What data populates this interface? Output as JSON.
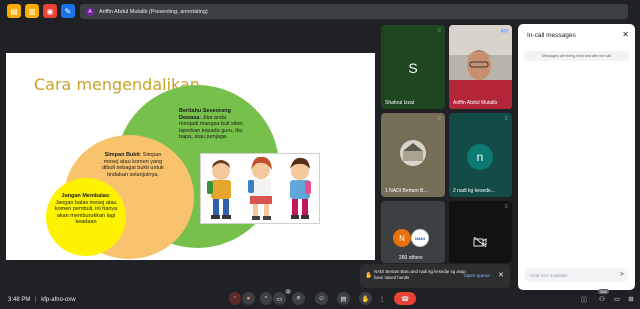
{
  "top_bar": {
    "presenting": {
      "avatar_letter": "A",
      "text": "Ariffin Abdul Mutalib (Presenting, annotating)"
    }
  },
  "slide": {
    "title": "Cara mengendalikan",
    "green": {
      "heading": "Beritahu Seseorang Dewasa",
      "body": ": Jika anda menjadi mangsa buli siber, laporkan kepada guru, ibu bapa, atau penjaga."
    },
    "orange": {
      "heading": "Simpan Bukti",
      "body": ": Simpan mesej atau komen yang dibuli sebagai bukti untuk tindakan selanjutnya."
    },
    "yellow": {
      "heading": "Jangan Membalas",
      "body": ": Jangan balas mesej atau komen pembuli, ini hanya akan memburukkan lagi keadaan"
    }
  },
  "participants": [
    {
      "letter": "S",
      "name": "Shahrul Izzat"
    },
    {
      "name": "Ariffin Abdul Mutalib"
    },
    {
      "name": "1⁨ NADI Bertam B..."
    },
    {
      "letter": "n",
      "name": "2⁨ nadi kg kesede..."
    },
    {
      "avatar_text": "NADI",
      "name": "260 others"
    },
    {
      "name": ""
    }
  ],
  "chat": {
    "title": "In-call messages",
    "notice": "Messages are being recorded with the call",
    "input_placeholder": "Chat isn't available"
  },
  "toast": {
    "text": "NADI Bertam Baru and nadi kg kesedar sg asap have raised hands",
    "action": "Open queue"
  },
  "bottom_bar": {
    "time": "3:48 PM",
    "separator": "|",
    "meeting_code": "kfp-afno-oxw",
    "hands_count": "2",
    "people_count": "264"
  },
  "colors": {
    "green_circle": "#77c04b",
    "orange_circle": "#f8c36c",
    "yellow_circle": "#fdf200",
    "end_call": "#ea4335"
  }
}
